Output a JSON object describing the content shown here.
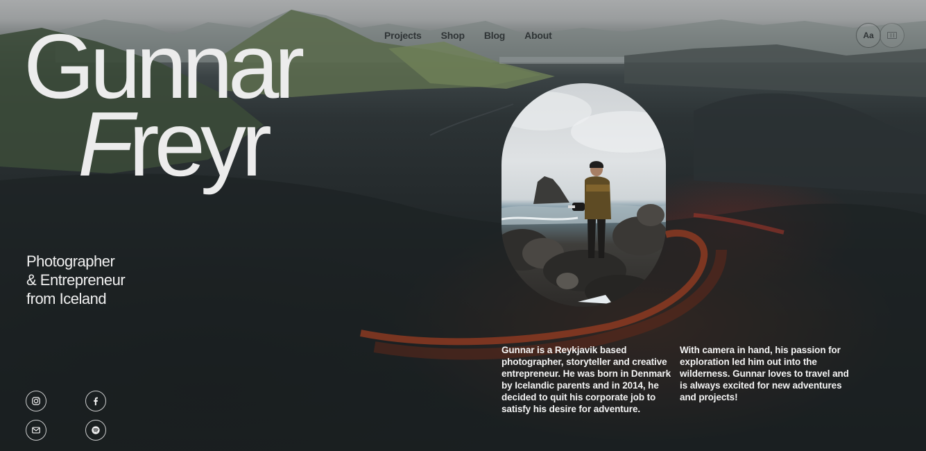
{
  "nav": {
    "items": [
      {
        "label": "Projects"
      },
      {
        "label": "Shop"
      },
      {
        "label": "Blog"
      },
      {
        "label": "About"
      }
    ]
  },
  "controls": {
    "font_toggle_label": "Aa",
    "layout_toggle_icon": "grid-view-icon"
  },
  "hero": {
    "first_name": "Gunnar",
    "last_name_initial": "F",
    "last_name_rest": "reyr",
    "tagline": [
      "Photographer",
      "& Entrepreneur",
      "from Iceland"
    ]
  },
  "portrait": {
    "icon": "portrait-photo"
  },
  "bio": {
    "paragraph_1": "Gunnar is a Reykjavik based photographer, storyteller and creative entrepreneur. He was born in Denmark by Icelandic parents and in 2014, he decided to quit his corporate job to satisfy his desire for adventure.",
    "paragraph_2": "With camera in hand, his passion for exploration led him out into the wilderness. Gunnar loves to travel and is always excited for new adventures and projects!"
  },
  "social": [
    {
      "icon": "instagram-icon"
    },
    {
      "icon": "facebook-icon"
    },
    {
      "icon": "mail-icon"
    },
    {
      "icon": "spotify-icon"
    }
  ],
  "colors": {
    "text": "#ececec",
    "nav_text": "#2f3436",
    "crater_red": "#9a3c22"
  }
}
